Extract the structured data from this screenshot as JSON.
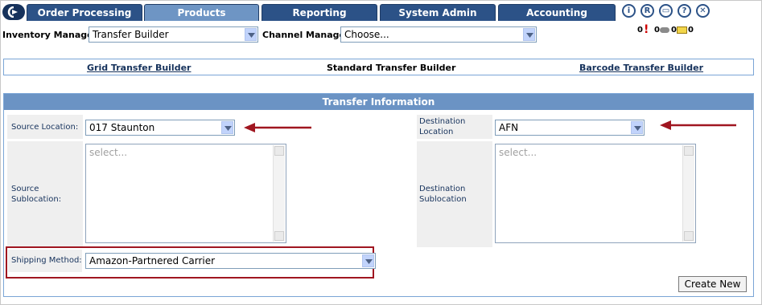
{
  "nav": {
    "tabs": [
      "Order Processing",
      "Products",
      "Reporting",
      "System Admin",
      "Accounting"
    ],
    "active_tab": "Products"
  },
  "header_icons": [
    "info-icon",
    "registered-icon",
    "save-icon",
    "help-icon",
    "close-icon"
  ],
  "notifications": {
    "alerts_count": "0",
    "comments_count": "0",
    "messages_count": "0"
  },
  "filters": {
    "inventory_managers_label": "Inventory Managers:",
    "inventory_managers_value": "Transfer Builder",
    "channel_managers_label": "Channel Managers:",
    "channel_managers_value": "Choose..."
  },
  "sub_nav": {
    "grid": "Grid Transfer Builder",
    "standard": "Standard Transfer Builder",
    "barcode": "Barcode Transfer Builder"
  },
  "transfer": {
    "title": "Transfer Information",
    "source_location_label": "Source Location:",
    "source_location_value": "017 Staunton",
    "destination_location_label_1": "Destination",
    "destination_location_label_2": "Location",
    "destination_location_value": "AFN",
    "source_sublocation_label_1": "Source",
    "source_sublocation_label_2": "Sublocation:",
    "source_sublocation_placeholder": "select...",
    "destination_sublocation_label_1": "Destination",
    "destination_sublocation_label_2": "Sublocation",
    "destination_sublocation_placeholder": "select...",
    "shipping_method_label": "Shipping Method:",
    "shipping_method_value": "Amazon-Partnered Carrier",
    "create_button": "Create New"
  },
  "colors": {
    "nav_blue": "#2c5287",
    "active_tab": "#6e95c4",
    "panel_header": "#6b93c4",
    "annotation_red": "#a01620"
  }
}
